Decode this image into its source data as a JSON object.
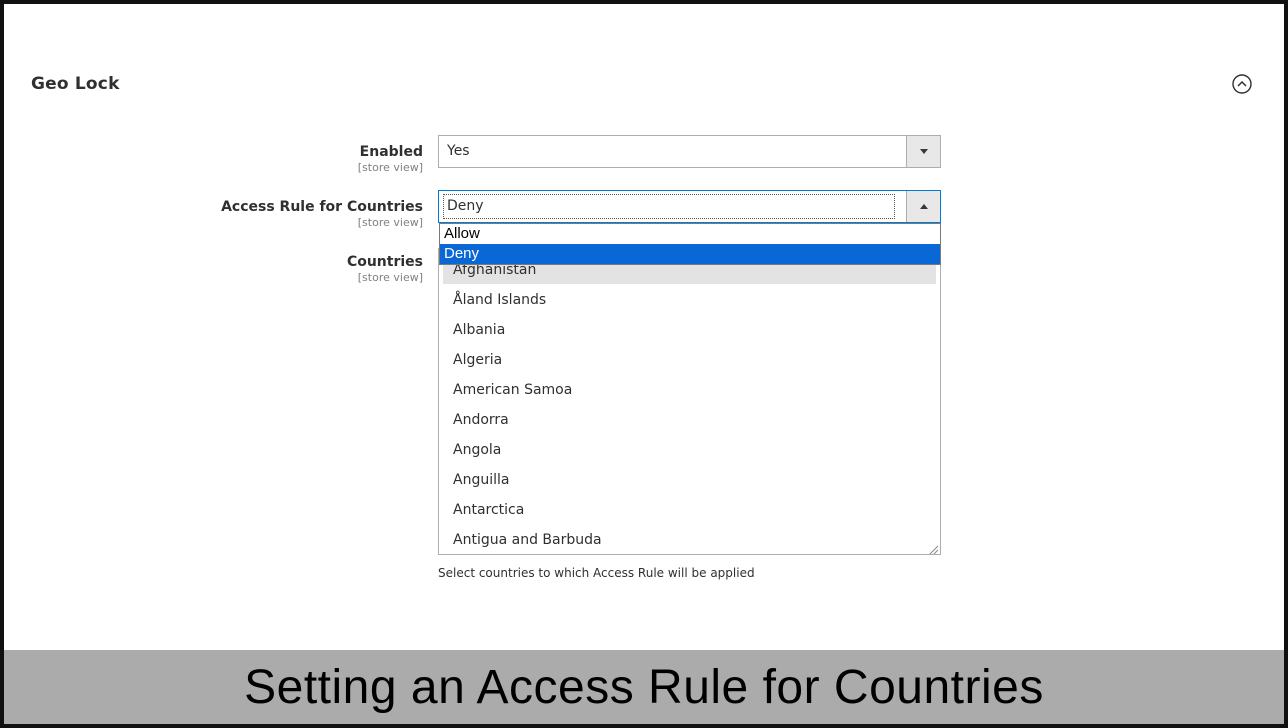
{
  "section": {
    "title": "Geo Lock",
    "collapse_icon": "chevron-up-circle-icon"
  },
  "fields": {
    "enabled": {
      "label": "Enabled",
      "scope": "[store view]",
      "value": "Yes"
    },
    "access_rule": {
      "label": "Access Rule for Countries",
      "scope": "[store view]",
      "value": "Deny"
    },
    "countries": {
      "label": "Countries",
      "scope": "[store view]"
    }
  },
  "access_rule_dropdown": {
    "options": [
      "Allow",
      "Deny"
    ],
    "selected": "Deny"
  },
  "countries_list": [
    "Afghanistan",
    "Åland Islands",
    "Albania",
    "Algeria",
    "American Samoa",
    "Andorra",
    "Angola",
    "Anguilla",
    "Antarctica",
    "Antigua and Barbuda"
  ],
  "countries_hint": "Select countries to which Access Rule will be applied",
  "caption": "Setting an Access Rule for Countries",
  "colors": {
    "selected_option": "#0a68d6",
    "focus_border": "#007bdb",
    "caption_bar": "#ababab"
  }
}
